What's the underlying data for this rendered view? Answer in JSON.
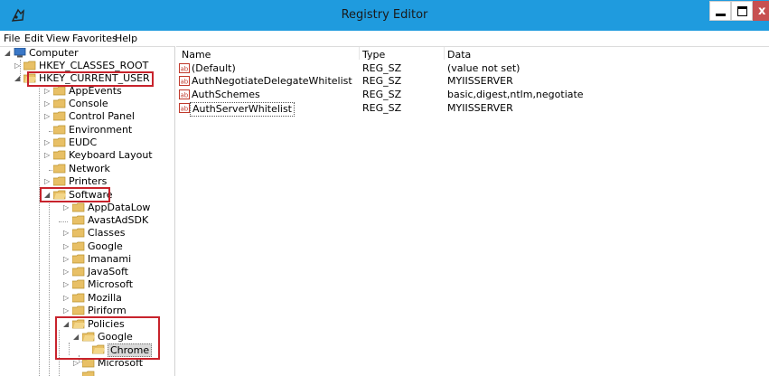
{
  "window": {
    "title": "Registry Editor"
  },
  "menu": [
    "File",
    "Edit",
    "View",
    "Favorites",
    "Help"
  ],
  "tree": [
    {
      "label": "Computer",
      "exp": "◢"
    },
    {
      "label": "HKEY_CLASSES_ROOT",
      "exp": "▷"
    },
    {
      "label": "HKEY_CURRENT_USER",
      "exp": "◢"
    },
    {
      "label": "AppEvents",
      "exp": "▷"
    },
    {
      "label": "Console",
      "exp": "▷"
    },
    {
      "label": "Control Panel",
      "exp": "▷"
    },
    {
      "label": "Environment",
      "exp": ""
    },
    {
      "label": "EUDC",
      "exp": "▷"
    },
    {
      "label": "Keyboard Layout",
      "exp": "▷"
    },
    {
      "label": "Network",
      "exp": ""
    },
    {
      "label": "Printers",
      "exp": "▷"
    },
    {
      "label": "Software",
      "exp": "◢"
    },
    {
      "label": "AppDataLow",
      "exp": "▷"
    },
    {
      "label": "AvastAdSDK",
      "exp": ""
    },
    {
      "label": "Classes",
      "exp": "▷"
    },
    {
      "label": "Google",
      "exp": "▷"
    },
    {
      "label": "Imanami",
      "exp": "▷"
    },
    {
      "label": "JavaSoft",
      "exp": "▷"
    },
    {
      "label": "Microsoft",
      "exp": "▷"
    },
    {
      "label": "Mozilla",
      "exp": "▷"
    },
    {
      "label": "Piriform",
      "exp": "▷"
    },
    {
      "label": "Policies",
      "exp": "◢"
    },
    {
      "label": "Google",
      "exp": "◢"
    },
    {
      "label": "Chrome",
      "exp": ""
    },
    {
      "label": "Microsoft",
      "exp": "▷"
    }
  ],
  "columns": {
    "name": "Name",
    "type": "Type",
    "data": "Data"
  },
  "values": [
    {
      "name": "(Default)",
      "type": "REG_SZ",
      "data": "(value not set)"
    },
    {
      "name": "AuthNegotiateDelegateWhitelist",
      "type": "REG_SZ",
      "data": "MYIISSERVER"
    },
    {
      "name": "AuthSchemes",
      "type": "REG_SZ",
      "data": "basic,digest,ntlm,negotiate"
    },
    {
      "name": "AuthServerWhitelist",
      "type": "REG_SZ",
      "data": "MYIISSERVER"
    }
  ],
  "colors": {
    "titlebar": "#1f9bde",
    "annotation": "#c8232c",
    "folder": "#e8c066"
  }
}
